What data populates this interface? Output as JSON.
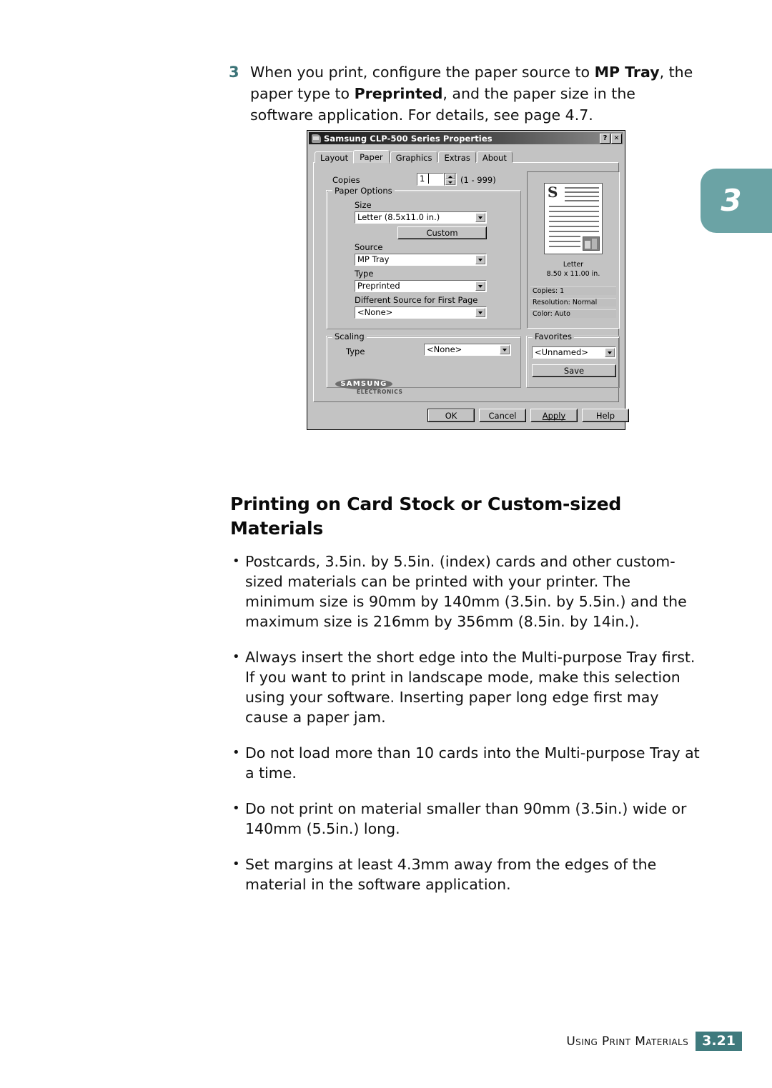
{
  "chapter_tab": {
    "number": "3"
  },
  "step": {
    "number": "3",
    "text_part1": "When you print, configure the paper source to ",
    "bold1": "MP Tray",
    "text_part2": ", the paper type to ",
    "bold2": "Preprinted",
    "text_part3": ", and the paper size in the software application. For details, see page 4.7."
  },
  "dialog": {
    "title": "Samsung CLP-500 Series Properties",
    "help_button": "?",
    "close_button": "✕",
    "tabs": [
      {
        "label": "Layout",
        "active": false
      },
      {
        "label": "Paper",
        "active": true
      },
      {
        "label": "Graphics",
        "active": false
      },
      {
        "label": "Extras",
        "active": false
      },
      {
        "label": "About",
        "active": false
      }
    ],
    "copies": {
      "label": "Copies",
      "value": "1",
      "range_hint": "(1 - 999)"
    },
    "paper_options": {
      "group_title": "Paper Options",
      "size_label": "Size",
      "size_value": "Letter (8.5x11.0 in.)",
      "custom_button": "Custom",
      "source_label": "Source",
      "source_value": "MP Tray",
      "type_label": "Type",
      "type_value": "Preprinted",
      "first_page_label": "Different Source for First Page",
      "first_page_value": "<None>"
    },
    "scaling": {
      "group_title": "Scaling",
      "type_label": "Type",
      "type_value": "<None>"
    },
    "preview": {
      "dropcap": "S",
      "paper_name": "Letter",
      "paper_dims": "8.50 x 11.00 in.",
      "info": [
        "Copies: 1",
        "Resolution: Normal",
        "Color: Auto"
      ]
    },
    "favorites": {
      "group_title": "Favorites",
      "value": "<Unnamed>",
      "save_button": "Save"
    },
    "brand": {
      "name": "SAMSUNG",
      "sub": "ELECTRONICS"
    },
    "buttons": {
      "ok": "OK",
      "cancel": "Cancel",
      "apply": "Apply",
      "help": "Help"
    }
  },
  "section": {
    "heading": "Printing on Card Stock or Custom-sized Materials",
    "bullets": [
      "Postcards, 3.5in. by 5.5in. (index) cards and other custom-sized materials can be printed with your printer. The minimum size is 90mm by 140mm (3.5in. by 5.5in.) and the maximum size is 216mm by 356mm (8.5in. by 14in.).",
      "Always insert the short edge into the Multi-purpose Tray first. If you want to print in landscape mode, make this selection using your software. Inserting paper long edge first may cause a paper jam.",
      "Do not load more than 10 cards into the Multi-purpose Tray at a time.",
      "Do not print on material smaller than 90mm (3.5in.) wide or 140mm (5.5in.) long.",
      "Set margins at least 4.3mm away from the edges of the material in the software application."
    ]
  },
  "footer": {
    "text": "Using Print Materials",
    "page": "3.21"
  },
  "colors": {
    "teal_tab": "#6ba3a5",
    "teal_step": "#3c7478",
    "teal_page_box": "#3f7a7d",
    "dialog_face": "#c3c3c3"
  }
}
